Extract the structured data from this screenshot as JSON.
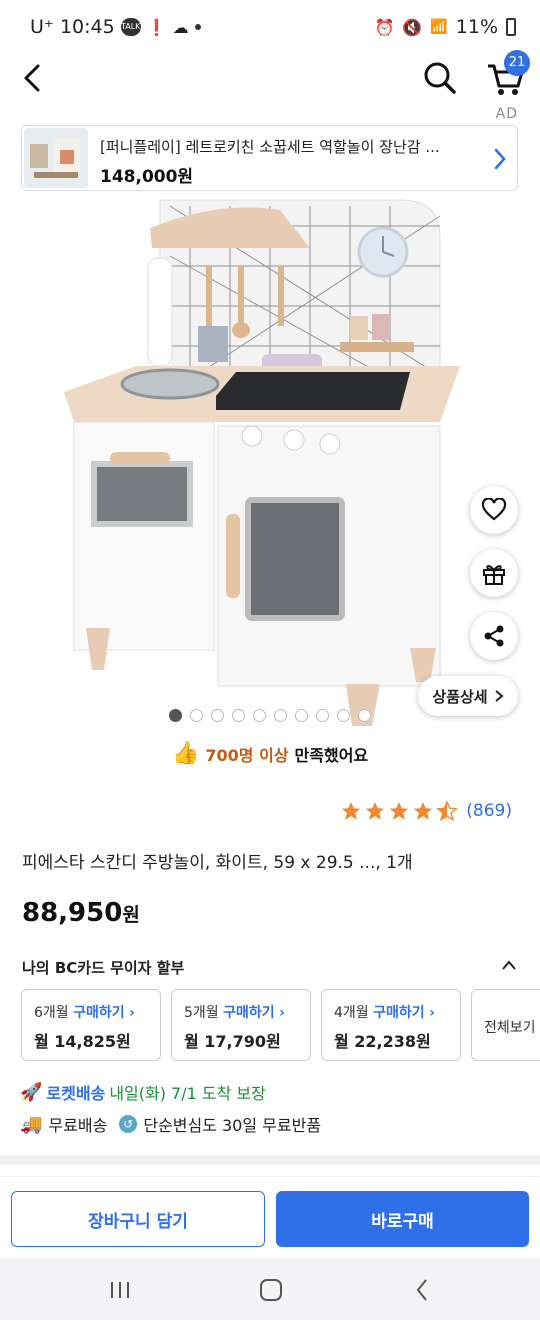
{
  "status_bar": {
    "carrier": "U⁺",
    "time": "10:45",
    "battery": "11%"
  },
  "header": {
    "cart_count": "21",
    "ad_label": "AD"
  },
  "ad": {
    "title": "[퍼니플레이] 레트로키친 소꿉세트 역할놀이 장난감 ...",
    "price": "148,000원"
  },
  "gallery": {
    "image_count": 10,
    "active_index": 0,
    "detail_button": "상품상세"
  },
  "satisfaction": {
    "highlight": "700명 이상",
    "rest": "만족했어요"
  },
  "rating": {
    "stars": 4.5,
    "count": "(869)"
  },
  "product": {
    "title": "피에스타 스칸디 주방놀이, 화이트, 59 x 29.5 ..., 1개",
    "price_number": "88,950",
    "price_unit": "원"
  },
  "card_section": {
    "title": "나의 BC카드 무이자 할부",
    "plans": [
      {
        "months": "6개월",
        "action": "구매하기",
        "monthly": "월 14,825원"
      },
      {
        "months": "5개월",
        "action": "구매하기",
        "monthly": "월 17,790원"
      },
      {
        "months": "4개월",
        "action": "구매하기",
        "monthly": "월 22,238원"
      }
    ],
    "view_all": "전체보기"
  },
  "delivery": {
    "rocket_label": "로켓배송",
    "rocket_text": "내일(화) 7/1 도착 보장",
    "free_shipping": "무료배송",
    "free_return": "단순변심도 30일 무료반품"
  },
  "actions": {
    "add_to_cart": "장바구니 담기",
    "buy_now": "바로구매"
  },
  "colors": {
    "accent": "#2f6fe8",
    "rocket_green": "#1a8f3c",
    "satisfaction_orange": "#c75a12"
  }
}
